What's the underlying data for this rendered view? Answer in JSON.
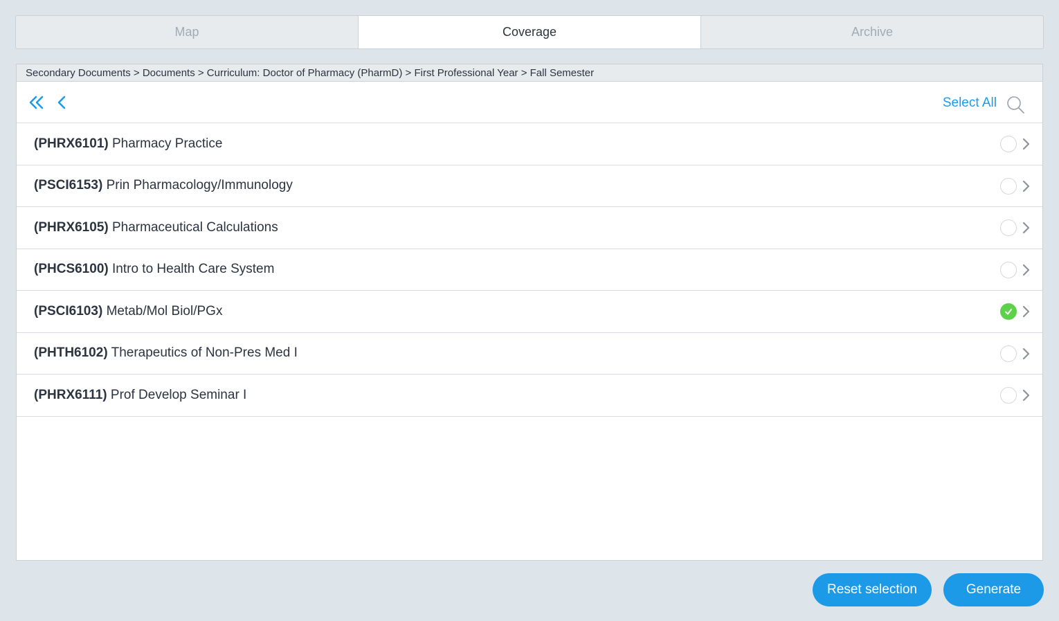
{
  "tabs": [
    {
      "label": "Map",
      "active": false
    },
    {
      "label": "Coverage",
      "active": true
    },
    {
      "label": "Archive",
      "active": false
    }
  ],
  "breadcrumb": "Secondary Documents > Documents > Curriculum: Doctor of Pharmacy (PharmD) > First Professional Year > Fall Semester",
  "toolbar": {
    "first_icon": "double-chevron-left-icon",
    "back_icon": "chevron-left-icon",
    "select_all_label": "Select All",
    "search_icon": "search-icon"
  },
  "courses": [
    {
      "code": "(PHRX6101)",
      "title": "Pharmacy Practice",
      "checked": false
    },
    {
      "code": "(PSCI6153)",
      "title": "Prin Pharmacology/Immunology",
      "checked": false
    },
    {
      "code": "(PHRX6105)",
      "title": "Pharmaceutical Calculations",
      "checked": false
    },
    {
      "code": "(PHCS6100)",
      "title": "Intro to Health Care System",
      "checked": false
    },
    {
      "code": "(PSCI6103)",
      "title": "Metab/Mol Biol/PGx",
      "checked": true
    },
    {
      "code": "(PHTH6102)",
      "title": "Therapeutics of Non-Pres Med I",
      "checked": false
    },
    {
      "code": "(PHRX6111)",
      "title": "Prof Develop Seminar I",
      "checked": false
    }
  ],
  "buttons": {
    "reset_label": "Reset selection",
    "generate_label": "Generate"
  },
  "colors": {
    "accent": "#1c9ae8",
    "checked": "#5ed14a",
    "background": "#dde4ea"
  }
}
